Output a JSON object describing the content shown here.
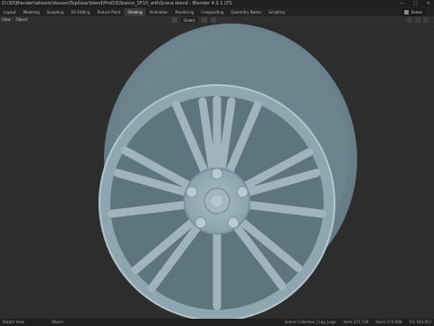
{
  "window": {
    "title": "D:\\3D\\Blender\\wheels\\Vossen\\TopGear\\blend\\ProD3\\Stance_SF10_withScene.blend - Blender 4.2.1 LTS",
    "controls": [
      "—",
      "□",
      "✕"
    ]
  },
  "workspace_tabs": [
    "Layout",
    "Modeling",
    "Sculpting",
    "UV Editing",
    "Texture Paint",
    "Shading",
    "Animation",
    "Rendering",
    "Compositing",
    "Geometry Nodes",
    "Scripting"
  ],
  "active_tab": "Shading",
  "scene": {
    "name": "Scene"
  },
  "viewport_header": {
    "left": [
      "View",
      "Object"
    ],
    "transform_orientation": "Global"
  },
  "statusbar": {
    "left": [
      "Rotate View",
      "Object"
    ],
    "right": [
      "Scene Collection | Cap_Logo",
      "Verts 271,728",
      "Faces 274,608",
      "Tris 543,452"
    ]
  },
  "colors": {
    "wheel": "#9fb4bd",
    "wheel_shadow": "#6f858f",
    "background": "#2d2d2d"
  },
  "icons": [
    "viewport-shading-icon",
    "orientation-icon",
    "snap-icon",
    "overlay-icon"
  ]
}
